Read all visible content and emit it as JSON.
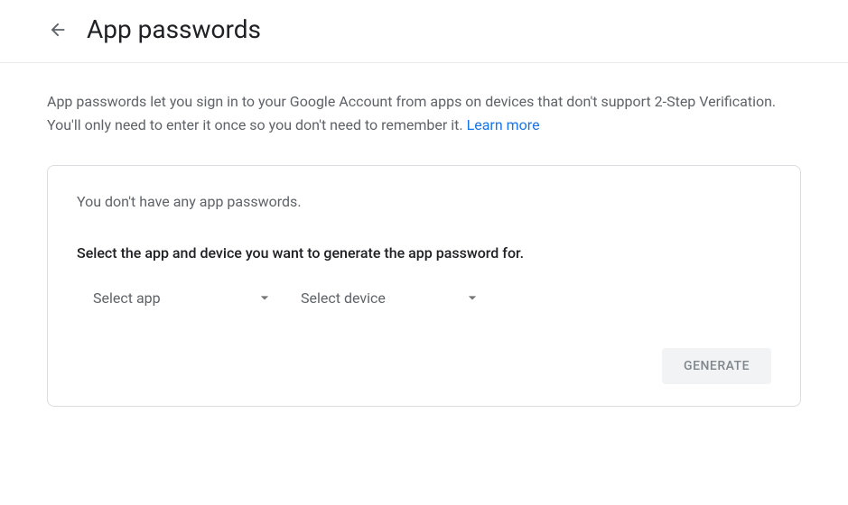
{
  "header": {
    "title": "App passwords"
  },
  "description": {
    "text": "App passwords let you sign in to your Google Account from apps on devices that don't support 2-Step Verification. You'll only need to enter it once so you don't need to remember it. ",
    "learn_more": "Learn more"
  },
  "card": {
    "empty_message": "You don't have any app passwords.",
    "instruction": "Select the app and device you want to generate the app password for.",
    "app_dropdown": {
      "label": "Select app"
    },
    "device_dropdown": {
      "label": "Select device"
    },
    "generate_button": "GENERATE"
  }
}
